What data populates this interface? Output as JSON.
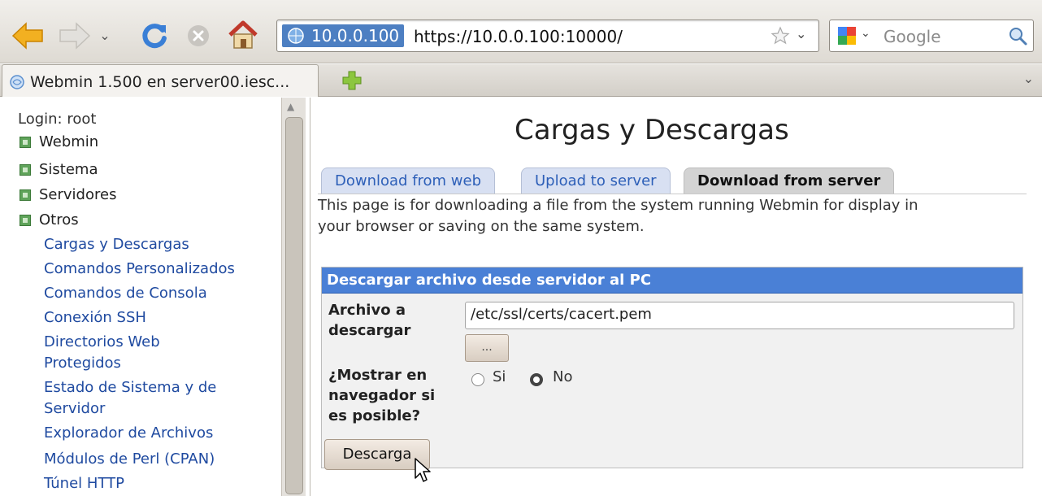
{
  "browser": {
    "site_identity": "10.0.0.100",
    "url": "https://10.0.0.100:10000/",
    "search_placeholder": "Google",
    "tab_title": "Webmin 1.500 en server00.iesc..."
  },
  "sidebar": {
    "login": "Login: root",
    "categories": [
      "Webmin",
      "Sistema",
      "Servidores",
      "Otros"
    ],
    "modules": [
      "Cargas y Descargas",
      "Comandos Personalizados",
      "Comandos de Consola",
      "Conexión SSH",
      "Directorios Web",
      "Protegidos",
      "Estado de Sistema y de",
      "Servidor",
      "Explorador de Archivos",
      "Módulos de Perl (CPAN)",
      "Túnel HTTP"
    ]
  },
  "main": {
    "title": "Cargas y Descargas",
    "tabs": [
      "Download from web",
      "Upload to server",
      "Download from server"
    ],
    "active_tab": "Download from server",
    "description_line1": "This page is for downloading a file from the system running Webmin for display in",
    "description_line2": "your browser or saving on the same system.",
    "form": {
      "header": "Descargar archivo desde servidor al PC",
      "file_label_1": "Archivo a",
      "file_label_2": "descargar",
      "file_value": "/etc/ssl/certs/cacert.pem",
      "browse_label": "...",
      "show_label_1": "¿Mostrar en",
      "show_label_2": "navegador si",
      "show_label_3": "es posible?",
      "option_yes": "Si",
      "option_no": "No",
      "selected": "No"
    },
    "submit_label": "Descarga"
  },
  "colors": {
    "form_header": "#4a80d6",
    "link": "#1f4aa0",
    "tab_inactive": "#d8e0f2"
  }
}
